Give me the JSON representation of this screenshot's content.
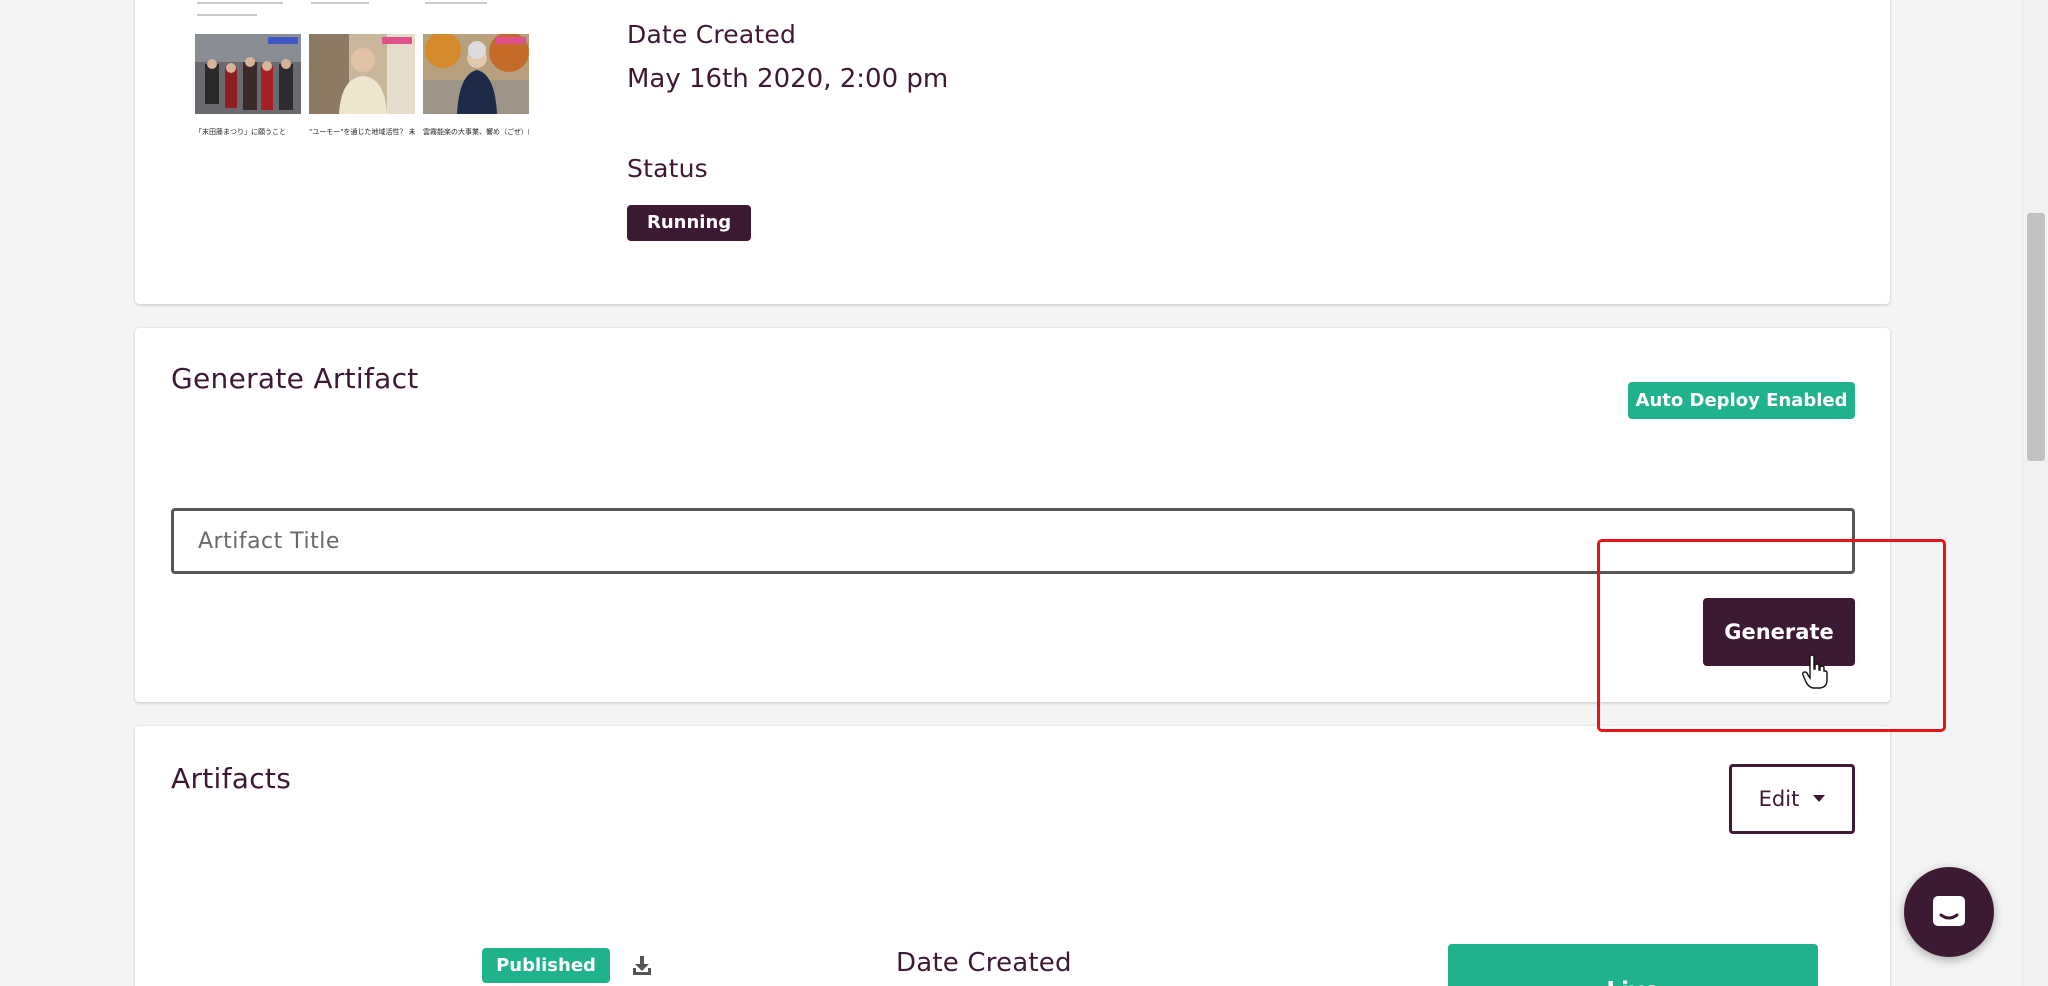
{
  "details": {
    "thumbnail_captions": [
      "「末田藤まつり」に願うこと",
      "\"ユーモー\"を通じた地域活性？ 未来につながる私学活仏をのこす｜客",
      "雲霧能楽の大事業、響め（ごぜ）師を多くの人に知ってほしい！｜道"
    ],
    "date_created_label": "Date Created",
    "date_created_value": "May 16th 2020, 2:00 pm",
    "status_label": "Status",
    "status_value": "Running"
  },
  "generate": {
    "title": "Generate Artifact",
    "auto_deploy_badge": "Auto Deploy Enabled",
    "artifact_title_placeholder": "Artifact Title",
    "generate_button": "Generate"
  },
  "artifacts": {
    "title": "Artifacts",
    "edit_button": "Edit",
    "rows": [
      {
        "published_badge": "Published",
        "date_created_label": "Date Created",
        "live_button": "Live"
      }
    ]
  },
  "colors": {
    "brand_dark": "#3d1a33",
    "accent_green": "#1fb28c",
    "highlight_red": "#e8121b"
  },
  "icons": {
    "download": "download-icon",
    "chevron": "caret-down-icon",
    "chat": "chat-icon",
    "cursor": "hand-cursor-icon"
  }
}
